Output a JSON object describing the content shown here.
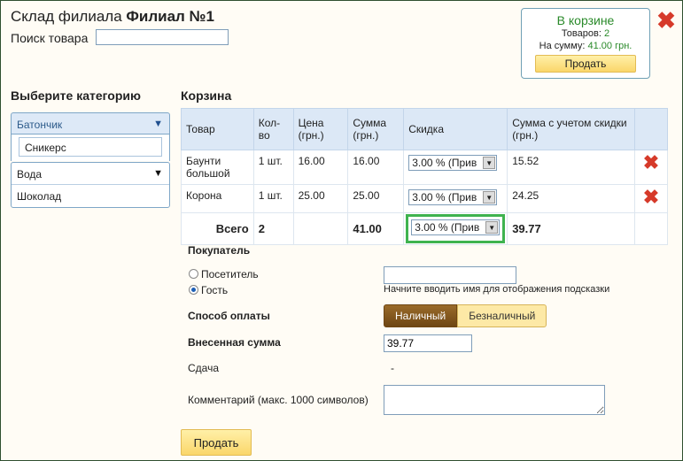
{
  "header": {
    "title_prefix": "Склад филиала",
    "title_branch": "Филиал №1",
    "search_label": "Поиск товара",
    "search_value": ""
  },
  "cart_summary": {
    "title": "В корзине",
    "items_label": "Товаров:",
    "items_value": "2",
    "sum_label": "На сумму:",
    "sum_value": "41.00 грн.",
    "sell_label": "Продать"
  },
  "categories": {
    "heading": "Выберите категорию",
    "items": [
      {
        "label": "Батончик",
        "expanded": true,
        "children": [
          "Сникерс"
        ]
      },
      {
        "label": "Вода",
        "expanded": false
      },
      {
        "label": "Шоколад",
        "expanded": false
      }
    ]
  },
  "basket": {
    "heading": "Корзина",
    "columns": [
      "Товар",
      "Кол-во",
      "Цена (грн.)",
      "Сумма (грн.)",
      "Скидка",
      "Сумма с учетом скидки (грн.)",
      ""
    ],
    "rows": [
      {
        "product": "Баунти большой",
        "qty": "1 шт.",
        "price": "16.00",
        "sum": "16.00",
        "discount": "3.00 % (Прив",
        "total": "15.52"
      },
      {
        "product": "Корона",
        "qty": "1 шт.",
        "price": "25.00",
        "sum": "25.00",
        "discount": "3.00 % (Прив",
        "total": "24.25"
      }
    ],
    "totals": {
      "label": "Всего",
      "qty": "2",
      "sum": "41.00",
      "discount": "3.00 % (Прив",
      "total": "39.77"
    }
  },
  "buyer": {
    "label": "Покупатель",
    "options": [
      "Посетитель",
      "Гость"
    ],
    "selected": "Гость",
    "hint": "Начните вводить имя для отображения подсказки",
    "name_value": ""
  },
  "payment": {
    "label": "Способ оплаты",
    "options": [
      "Наличный",
      "Безналичный"
    ],
    "selected": "Наличный"
  },
  "paid": {
    "label": "Внесенная сумма",
    "value": "39.77"
  },
  "change": {
    "label": "Сдача",
    "value": "-"
  },
  "comment": {
    "label": "Комментарий (макс. 1000 символов)",
    "value": ""
  },
  "sell_button": "Продать",
  "colors": {
    "accent_green": "#2a8a2a",
    "highlight": "#3fb34f",
    "delete_red": "#d63a2a",
    "cash_active": "#6e4614"
  }
}
